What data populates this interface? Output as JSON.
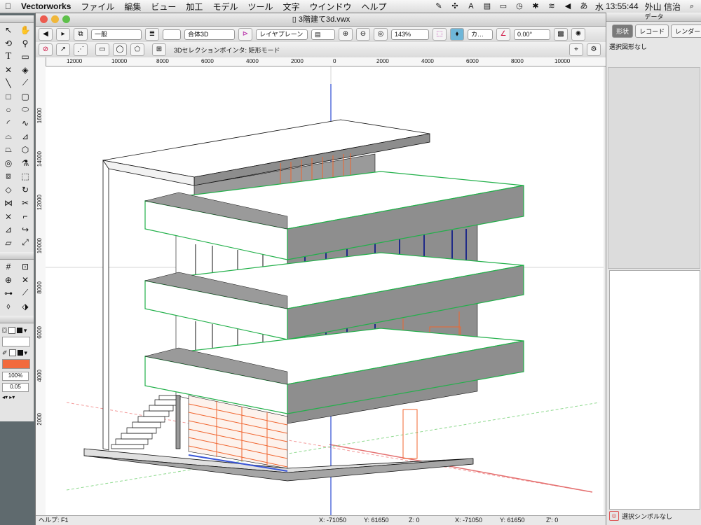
{
  "menubar": {
    "app_name": "Vectorworks",
    "items": [
      "ファイル",
      "編集",
      "ビュー",
      "加工",
      "モデル",
      "ツール",
      "文字",
      "ウインドウ",
      "ヘルプ"
    ],
    "status": {
      "day": "水",
      "time": "13:55:44",
      "user": "外山 信治"
    }
  },
  "window": {
    "title": "3階建て3d.vwx"
  },
  "toolbar1": {
    "class_select": "一般",
    "view_select": "合体3D",
    "layer_select": "レイヤプレーン",
    "zoom": "143%",
    "render_select": "カ…",
    "angle": "0.00°"
  },
  "toolbar2": {
    "mode_label": "3Dセレクションポインタ: 矩形モード"
  },
  "ruler_h": [
    "12000",
    "10000",
    "8000",
    "6000",
    "4000",
    "2000",
    "0",
    "2000",
    "4000",
    "6000",
    "8000",
    "10000"
  ],
  "ruler_v": [
    "16000",
    "14000",
    "12000",
    "10000",
    "8000",
    "6000",
    "4000",
    "2000"
  ],
  "attributes": {
    "zoom": "100%",
    "line_weight": "0.05",
    "fill_color": "#f26a3d"
  },
  "statusbar": {
    "help": "ヘルプ: F1",
    "x": "X:  -71050",
    "y": "Y:  61650",
    "z": "Z:  0",
    "x2": "X:  -71050",
    "y2": "Y:  61650",
    "z2": "Z':  0"
  },
  "data_palette": {
    "title": "データ",
    "tabs": [
      "形状",
      "レコード",
      "レンダー"
    ],
    "selection": "選択図形なし",
    "symbol": "選択シンボルなし"
  },
  "colors": {
    "accent_green": "#22b04a",
    "accent_orange": "#f0652f",
    "axis_blue": "#3b57d6",
    "wall_gray": "#8e8e8e"
  }
}
